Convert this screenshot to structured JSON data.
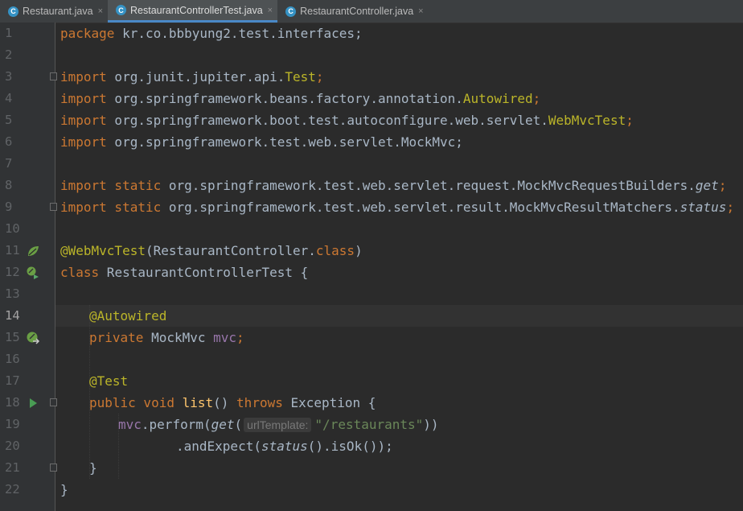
{
  "tabs": [
    {
      "label": "Restaurant.java",
      "icon": "java-class-icon",
      "active": false
    },
    {
      "label": "RestaurantControllerTest.java",
      "icon": "java-class-icon",
      "active": true
    },
    {
      "label": "RestaurantController.java",
      "icon": "java-class-icon",
      "active": false
    }
  ],
  "close_glyph": "×",
  "class_icon_letter": "C",
  "editor": {
    "current_line": 14,
    "line_numbers": [
      "1",
      "2",
      "3",
      "4",
      "5",
      "6",
      "7",
      "8",
      "9",
      "10",
      "11",
      "12",
      "13",
      "14",
      "15",
      "16",
      "17",
      "18",
      "19",
      "20",
      "21",
      "22"
    ],
    "code": {
      "l1": {
        "kw": "package",
        "rest": " kr.co.bbbyung2.test.interfaces;"
      },
      "l3": {
        "kw": "import",
        "rest": " org.junit.jupiter.api.",
        "cls": "Test",
        "end": ";"
      },
      "l4": {
        "kw": "import",
        "rest": " org.springframework.beans.factory.annotation.",
        "cls": "Autowired",
        "end": ";"
      },
      "l5": {
        "kw": "import",
        "rest": " org.springframework.boot.test.autoconfigure.web.servlet.",
        "cls": "WebMvcTest",
        "end": ";"
      },
      "l6": {
        "kw": "import",
        "rest": " org.springframework.test.web.servlet.MockMvc;"
      },
      "l8": {
        "kw": "import static",
        "rest": " org.springframework.test.web.servlet.request.MockMvcRequestBuilders.",
        "method": "get",
        "end": ";"
      },
      "l9": {
        "kw": "import static",
        "rest": " org.springframework.test.web.servlet.result.MockMvcResultMatchers.",
        "method": "status",
        "end": ";"
      },
      "l11": {
        "ann": "@WebMvcTest",
        "rest": "(RestaurantController.",
        "kw": "class",
        "end": ")"
      },
      "l12": {
        "kw": "class",
        "rest": " RestaurantControllerTest {"
      },
      "l14": {
        "ann": "@Autowired"
      },
      "l15": {
        "kw": "private",
        "rest": " MockMvc ",
        "fld": "mvc",
        "end": ";"
      },
      "l17": {
        "ann": "@Test"
      },
      "l18": {
        "kw": "public void",
        "sp": " ",
        "fn": "list",
        "rest": "() ",
        "kw2": "throws",
        "end": " Exception {"
      },
      "l19": {
        "fld": "mvc",
        "rest": ".perform(",
        "method": "get",
        "open": "(",
        "hint": "urlTemplate:",
        "str": "\"/restaurants\"",
        "end": "))"
      },
      "l20": {
        "rest": ".andExpect(",
        "method": "status",
        "end": "().isOk());"
      },
      "l21": {
        "text": "}"
      },
      "l22": {
        "text": "}"
      }
    }
  },
  "colors": {
    "background": "#2b2b2b",
    "keyword": "#cc7832",
    "annotation": "#bbb529",
    "field": "#9876aa",
    "string": "#6a8759",
    "method": "#ffc66d"
  }
}
